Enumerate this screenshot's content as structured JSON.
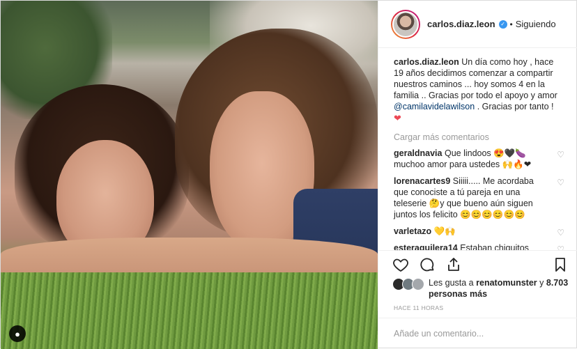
{
  "post": {
    "username": "carlos.diaz.leon",
    "follow_dot": "•",
    "follow_status": "Siguiendo",
    "caption": "Un día como hoy , hace 19 años decidimos comenzar a compartir nuestros caminos ... hoy somos 4 en la familia .. Gracias por todo el apoyo y amor",
    "mention": "@camilavidelawilson",
    "caption_end": ". Gracias por tanto !",
    "caption_emoji": "❤",
    "load_more": "Cargar más comentarios"
  },
  "comments": [
    {
      "user": "geraldnavia",
      "text": "Que lindoos 😍🖤🍆 muchoo amor para ustedes 🙌🔥❤"
    },
    {
      "user": "lorenacartes9",
      "text": "Siiiii..... Me acordaba que conociste a tú pareja en una teleserie 🤔y que bueno aún siguen juntos los felicito 😊😊😊😊😊😊"
    },
    {
      "user": "varletazo",
      "text": "💛🙌"
    },
    {
      "user": "esteraguilera14",
      "text": "Estaban chiquitos"
    }
  ],
  "likes": {
    "prefix": "Les gusta a",
    "user": "renatomunster",
    "conj": "y",
    "count": "8.703 personas más"
  },
  "timestamp": "HACE 11 HORAS",
  "comment_input": {
    "placeholder": "Añade un comentario..."
  },
  "colors": {
    "accent": "#3897f0",
    "heart": "#ed4956",
    "muted": "#999999"
  }
}
